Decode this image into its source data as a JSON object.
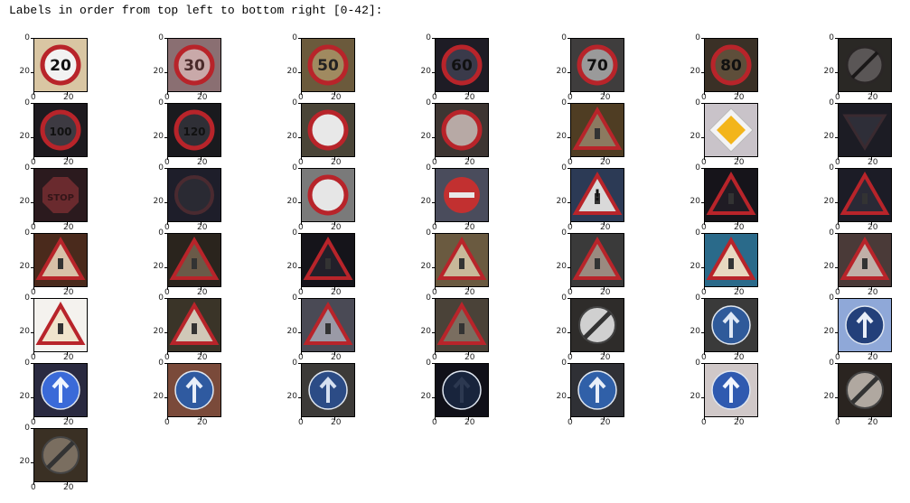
{
  "header": {
    "text": "Labels in order from top left to bottom right [0-42]:"
  },
  "axis": {
    "y_ticks": [
      "0",
      "20"
    ],
    "x_ticks": [
      "0",
      "20"
    ]
  },
  "signs": [
    {
      "bg": "#d9c6a3",
      "kind": "round-red",
      "color": "#f2f2f2",
      "text": "20",
      "tc": "#111"
    },
    {
      "bg": "#8a6f72",
      "kind": "round-red",
      "color": "#c9a9a9",
      "text": "30",
      "tc": "#4a2a2a"
    },
    {
      "bg": "#6b5a3c",
      "kind": "round-red",
      "color": "#a08a60",
      "text": "50",
      "tc": "#222"
    },
    {
      "bg": "#1e1c25",
      "kind": "round-red",
      "color": "#3a3a4a",
      "text": "60",
      "tc": "#111"
    },
    {
      "bg": "#3f3d3d",
      "kind": "round-red",
      "color": "#9a9a9a",
      "text": "70",
      "tc": "#111"
    },
    {
      "bg": "#3a3026",
      "kind": "round-red",
      "color": "#5e4e3a",
      "text": "80",
      "tc": "#111"
    },
    {
      "bg": "#2a2825",
      "kind": "round-bar",
      "color": "#5a5656",
      "text": "",
      "tc": "#111"
    },
    {
      "bg": "#1d1a1f",
      "kind": "round-red",
      "color": "#3d3a42",
      "text": "100",
      "tc": "#111"
    },
    {
      "bg": "#1a1a1e",
      "kind": "round-red",
      "color": "#2f2f36",
      "text": "120",
      "tc": "#111"
    },
    {
      "bg": "#4a4538",
      "kind": "round-red",
      "color": "#e8e8e8",
      "text": "",
      "tc": "#111"
    },
    {
      "bg": "#3d3532",
      "kind": "round-red",
      "color": "#b7a9a5",
      "text": "",
      "tc": "#111"
    },
    {
      "bg": "#4f3d23",
      "kind": "triangle",
      "color": "#8c7a60",
      "text": "",
      "tc": "#111"
    },
    {
      "bg": "#c9c3c9",
      "kind": "diamond",
      "color": "#f3b51a",
      "text": "",
      "tc": "#111"
    },
    {
      "bg": "#1c1c24",
      "kind": "yield",
      "color": "#2e2e38",
      "text": "",
      "tc": "#111"
    },
    {
      "bg": "#2b1a1e",
      "kind": "stop",
      "color": "#6a2a2e",
      "text": "STOP",
      "tc": "#331518"
    },
    {
      "bg": "#1e1e2a",
      "kind": "round-dark",
      "color": "#2a2a33",
      "text": "",
      "tc": "#111"
    },
    {
      "bg": "#7a7a7a",
      "kind": "round-red",
      "color": "#e6e6e6",
      "text": "",
      "tc": "#111"
    },
    {
      "bg": "#4a4c5c",
      "kind": "noentry",
      "color": "#c23030",
      "text": "",
      "tc": "#111"
    },
    {
      "bg": "#2c3a55",
      "kind": "triangle",
      "color": "#d9d9d9",
      "text": "!",
      "tc": "#111"
    },
    {
      "bg": "#16141a",
      "kind": "triangle",
      "color": "#1f1c24",
      "text": "",
      "tc": "#111"
    },
    {
      "bg": "#1c1c26",
      "kind": "triangle",
      "color": "#2a2a36",
      "text": "",
      "tc": "#111"
    },
    {
      "bg": "#4a2a1c",
      "kind": "triangle",
      "color": "#d8c0a8",
      "text": "",
      "tc": "#111"
    },
    {
      "bg": "#2a241d",
      "kind": "triangle",
      "color": "#6a5a48",
      "text": "",
      "tc": "#111"
    },
    {
      "bg": "#15141a",
      "kind": "triangle",
      "color": "#22202a",
      "text": "",
      "tc": "#111"
    },
    {
      "bg": "#6a5a40",
      "kind": "triangle",
      "color": "#c8b89a",
      "text": "",
      "tc": "#111"
    },
    {
      "bg": "#3a3a3a",
      "kind": "triangle",
      "color": "#9a8a80",
      "text": "",
      "tc": "#111"
    },
    {
      "bg": "#2a6a8a",
      "kind": "triangle",
      "color": "#e8d8c0",
      "text": "",
      "tc": "#111"
    },
    {
      "bg": "#4a3a38",
      "kind": "triangle",
      "color": "#c0b0a8",
      "text": "",
      "tc": "#111"
    },
    {
      "bg": "#f4f2ee",
      "kind": "triangle",
      "color": "#f0e4cc",
      "text": "",
      "tc": "#111"
    },
    {
      "bg": "#3a3428",
      "kind": "triangle",
      "color": "#d0c8b8",
      "text": "",
      "tc": "#111"
    },
    {
      "bg": "#4a4a55",
      "kind": "triangle",
      "color": "#9a9aa6",
      "text": "",
      "tc": "#111"
    },
    {
      "bg": "#4a4238",
      "kind": "triangle",
      "color": "#7a6e60",
      "text": "",
      "tc": "#111"
    },
    {
      "bg": "#2e2c2a",
      "kind": "end",
      "color": "#d0d0d0",
      "text": "",
      "tc": "#111"
    },
    {
      "bg": "#3a3a3a",
      "kind": "round-blue",
      "color": "#2f5a9a",
      "text": "",
      "tc": "#dfe8f5"
    },
    {
      "bg": "#8fa8d8",
      "kind": "round-blue",
      "color": "#23407a",
      "text": "",
      "tc": "#e8eef8"
    },
    {
      "bg": "#2a2a40",
      "kind": "round-blue",
      "color": "#3a6ad8",
      "text": "",
      "tc": "#f0f6ff"
    },
    {
      "bg": "#7a4a3a",
      "kind": "round-blue",
      "color": "#2f5aa0",
      "text": "",
      "tc": "#e8eef8"
    },
    {
      "bg": "#3c3a38",
      "kind": "round-blue",
      "color": "#2c4c86",
      "text": "",
      "tc": "#d6e0f0"
    },
    {
      "bg": "#101018",
      "kind": "round-blue",
      "color": "#18243c",
      "text": "",
      "tc": "#2c3850"
    },
    {
      "bg": "#2f3035",
      "kind": "round-blue",
      "color": "#3060a8",
      "text": "",
      "tc": "#e8eef8"
    },
    {
      "bg": "#d0c8c8",
      "kind": "round-blue",
      "color": "#2f5ab0",
      "text": "",
      "tc": "#f2f6ff"
    },
    {
      "bg": "#2a2420",
      "kind": "end",
      "color": "#b0a8a0",
      "text": "",
      "tc": "#111"
    },
    {
      "bg": "#3a3024",
      "kind": "end",
      "color": "#7a6e60",
      "text": "",
      "tc": "#111"
    }
  ]
}
